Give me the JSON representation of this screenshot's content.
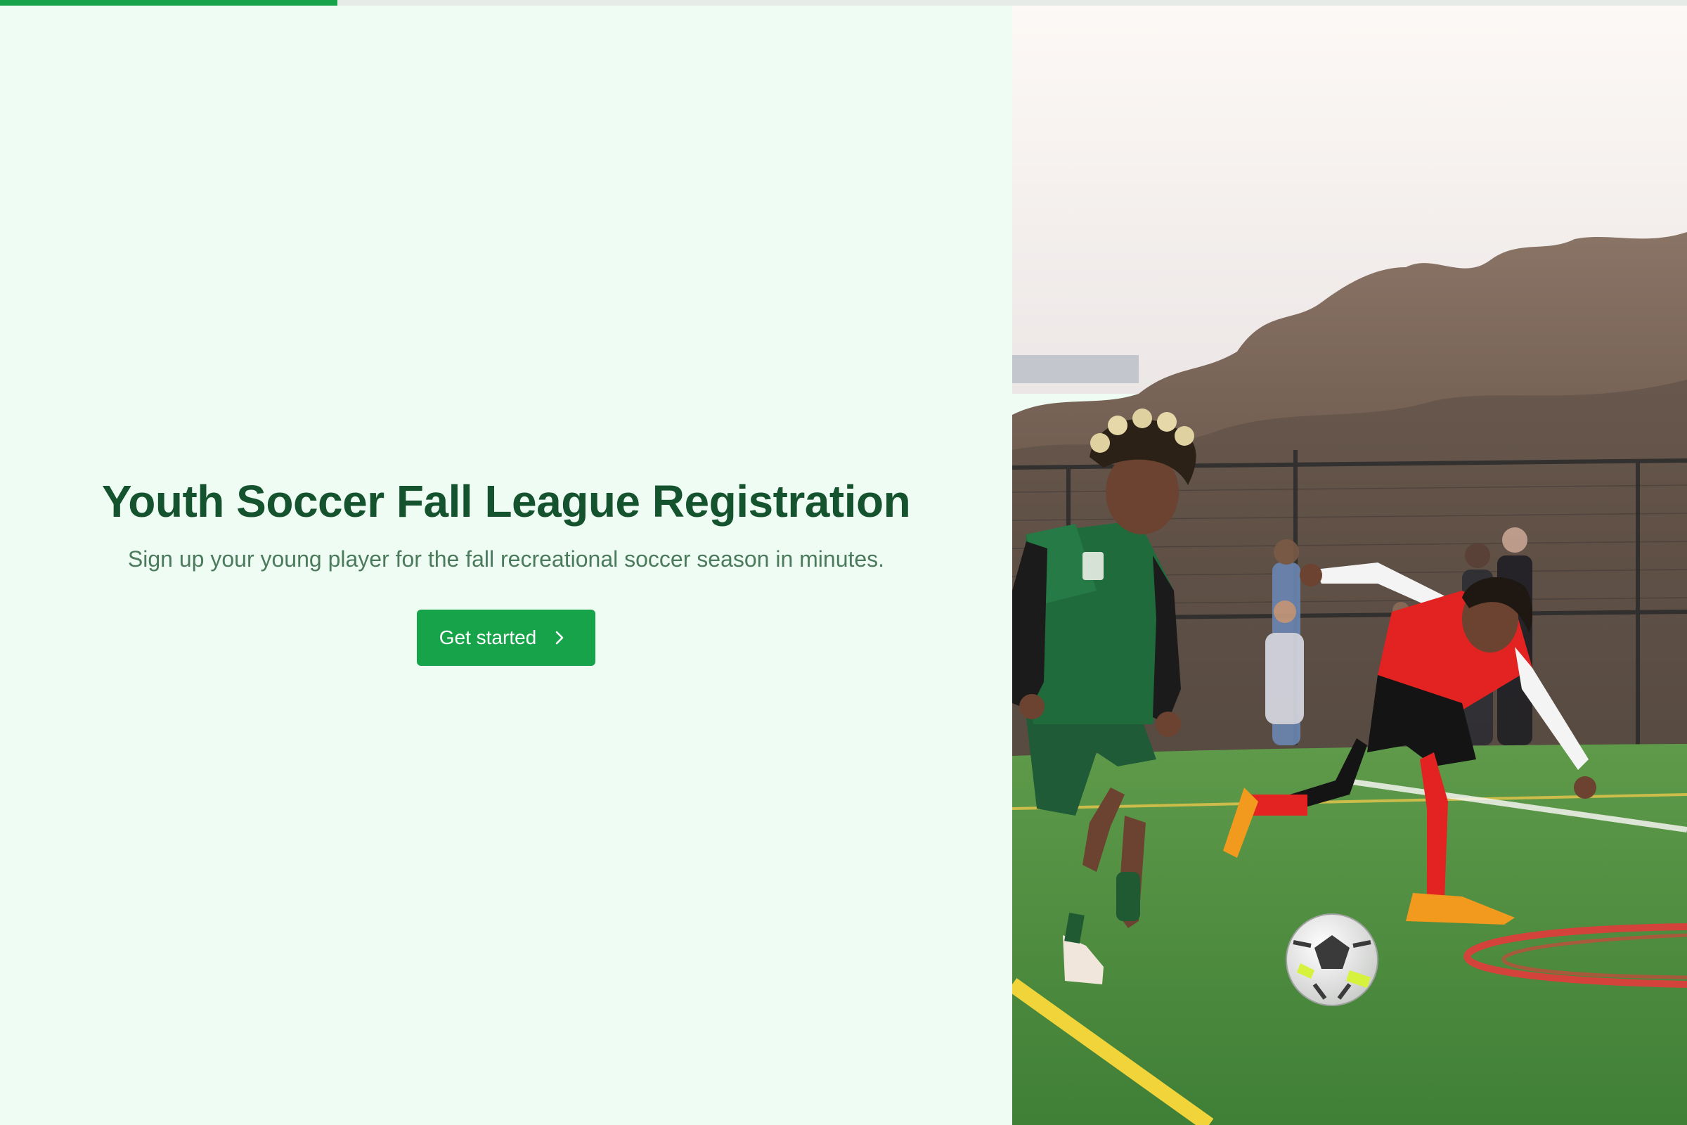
{
  "progress": {
    "fraction": 0.2,
    "track_color": "#e6ebe8",
    "fill_color": "#16a34a"
  },
  "hero": {
    "title": "Youth Soccer Fall League Registration",
    "subtitle": "Sign up your young player for the fall recreational soccer season in minutes.",
    "cta_label": "Get started",
    "cta_icon": "chevron-right-icon"
  },
  "photo": {
    "description_icon": "soccer-photo"
  },
  "colors": {
    "background": "#effcf3",
    "title": "#14532d",
    "subtitle": "#4b7a5c",
    "accent": "#16a34a"
  }
}
